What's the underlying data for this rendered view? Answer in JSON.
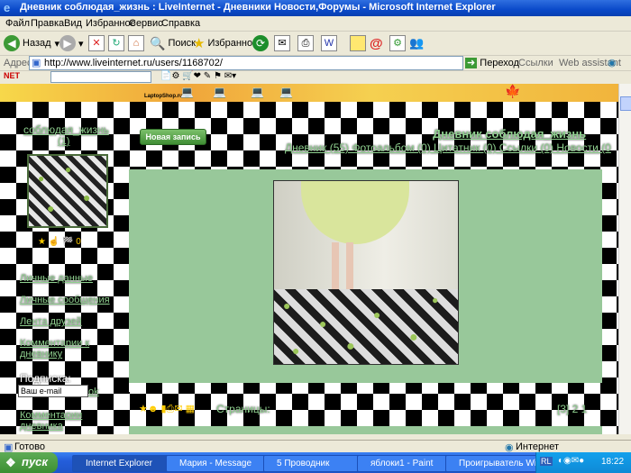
{
  "window": {
    "title": "Дневник соблюдая_жизнь : LiveInternet - Дневники Новости,Форумы - Microsoft Internet Explorer"
  },
  "menu": [
    "Файл",
    "Правка",
    "Вид",
    "Избранное",
    "Сервис",
    "Справка"
  ],
  "toolbar": {
    "back": "Назад",
    "search": "Поиск",
    "favorites": "Избранное"
  },
  "address": {
    "label": "Адрес:",
    "url": "http://www.liveinternet.ru/users/1168702/",
    "go": "Переход",
    "links": "Ссылки",
    "assistant": "Web assistant"
  },
  "nav": {
    "brand": "NET"
  },
  "ad": {
    "site": "LaptopShop.ru"
  },
  "blog": {
    "new_post": "Новая запись",
    "user_name": "соблюдая_жизнь",
    "user_count": "(1)",
    "title": "Дневник соблюдая_жизнь",
    "tabs": "Дневник (55) Фотоальбом (0) Цитатник (0) Ссылки (0) Новости (0",
    "stars": "★ ☝ 🏁 0",
    "side_links": [
      "Личные данные",
      "Личные сообщения",
      "Лента друзей",
      "Комментарии к дневнику"
    ],
    "subscribe_label": "Подписка:",
    "subscribe_placeholder": "Ваш e-mail",
    "subscribe_ok": "ok",
    "side_last": "Комментарии дневника",
    "pages_label": "Страницы:",
    "pages": "[3] 2 1"
  },
  "status": {
    "left": "Готово",
    "right": "Интернет"
  },
  "taskbar": {
    "start": "пуск",
    "tasks": [
      "Internet Explorer",
      "Мария - Message",
      "5 Проводник",
      "яблоки1 - Paint",
      "Проигрыватель Wi..."
    ],
    "tray_lang": "RL",
    "clock": "18:22"
  }
}
